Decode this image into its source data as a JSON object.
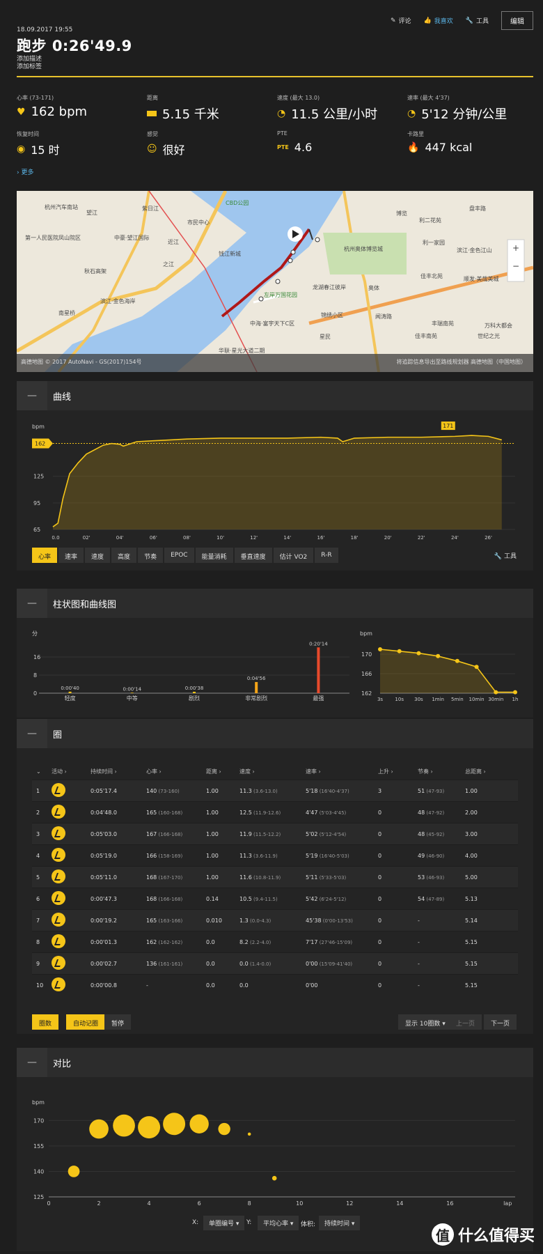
{
  "header": {
    "comment": "评论",
    "like": "我喜欢",
    "tools": "工具",
    "edit": "编辑",
    "date": "18.09.2017 19:55",
    "title": "跑步",
    "duration": "0:26'49.9",
    "add_desc": "添加描述",
    "add_tag": "添加标签"
  },
  "stats": {
    "hr_label": "心率 (73-171)",
    "hr_val": "162 bpm",
    "dist_label": "距离",
    "dist_val": "5.15 千米",
    "speed_label": "速度 (最大 13.0)",
    "speed_val": "11.5 公里/小时",
    "pace_label": "速率 (最大 4'37)",
    "pace_val": "5'12 分钟/公里",
    "recovery_label": "恢复时间",
    "recovery_val": "15 时",
    "feel_label": "感觉",
    "feel_val": "很好",
    "pte_label": "PTE",
    "pte_val": "4.6",
    "cal_label": "卡路里",
    "cal_val": "447 kcal",
    "more": "更多"
  },
  "map": {
    "labels": [
      "杭州汽车南站",
      "望江",
      "紫日江",
      "CBD公园",
      "博览",
      "利二花苑",
      "盘丰路",
      "第一人民医院凤山院区",
      "中豪·望江国际",
      "近江",
      "市民中心",
      "钱江新城",
      "杭州奥体博览城",
      "利一家园",
      "滨江·金色江山",
      "秋石高架",
      "之江",
      "龙湖春江彼岸",
      "佳丰北苑",
      "顺发·美哉美城",
      "左岸万国花园",
      "滨江·金色海岸",
      "南星桥",
      "中海·富宇天下C区",
      "锦绣小区",
      "奥体",
      "丰瑞南苑",
      "万科大都会",
      "星民",
      "华联·星光大道二期",
      "闻涛路",
      "世纪之光",
      "佳丰南苑"
    ],
    "footer_left": "高德地图 © 2017 AutoNavi - GS(2017)154号",
    "footer_right": "将追踪信息导出至路线规划器    高德地图（中国地图）"
  },
  "curve": {
    "title": "曲线",
    "unit": "bpm",
    "avg_label": "162",
    "max_label": "171",
    "yticks": [
      "125",
      "95",
      "65"
    ],
    "xticks": [
      "0.0",
      "02'",
      "04'",
      "06'",
      "08'",
      "10'",
      "12'",
      "14'",
      "16'",
      "18'",
      "20'",
      "22'",
      "24'",
      "26'"
    ],
    "tabs": [
      "心率",
      "速率",
      "速度",
      "高度",
      "节奏",
      "EPOC",
      "能量消耗",
      "垂直速度",
      "估计 VO2",
      "R-R"
    ],
    "tools": "工具"
  },
  "chart_data": [
    {
      "type": "line",
      "title": "",
      "ylabel": "bpm",
      "ylim": [
        65,
        175
      ],
      "x_unit": "minutes",
      "x": [
        0,
        0.3,
        0.6,
        1,
        1.5,
        2,
        3,
        3.5,
        4,
        4.2,
        5,
        6,
        8,
        10,
        12,
        14,
        16,
        17,
        17.3,
        18,
        20,
        22,
        24,
        25,
        26,
        26.8
      ],
      "series": [
        {
          "name": "",
          "values": [
            68,
            72,
            100,
            128,
            140,
            150,
            160,
            162,
            161,
            159,
            164,
            165,
            167,
            168,
            168,
            168,
            169,
            168,
            164,
            168,
            169,
            169,
            170,
            171,
            170,
            166
          ]
        }
      ],
      "average": 162,
      "max": 171
    },
    {
      "type": "bar",
      "title": "",
      "ylabel": "分",
      "categories": [
        "轻度",
        "中等",
        "剧烈",
        "非常剧烈",
        "最强"
      ],
      "values": [
        0.67,
        0.23,
        0.63,
        4.93,
        20.23
      ],
      "labels": [
        "0:00'40",
        "0:00'14",
        "0:00'38",
        "0:04'56",
        "0:20'14"
      ],
      "yticks": [
        "16",
        "8",
        "0"
      ],
      "ylim": [
        0,
        24
      ]
    },
    {
      "type": "area",
      "title": "",
      "ylabel": "bpm",
      "categories": [
        "3s",
        "10s",
        "30s",
        "1min",
        "5min",
        "10min",
        "30min",
        "1h"
      ],
      "values": [
        171,
        170.6,
        170.2,
        169.6,
        168.6,
        167.4,
        162.2,
        162.2
      ],
      "yticks": [
        "170",
        "166",
        "162"
      ],
      "ylim": [
        162,
        172
      ]
    },
    {
      "type": "scatter",
      "title": "",
      "ylabel": "bpm",
      "xlabel": "lap",
      "x": [
        1,
        2,
        3,
        4,
        5,
        6,
        7,
        8,
        9
      ],
      "y": [
        140,
        165,
        167,
        166,
        168,
        168,
        165,
        162,
        136
      ],
      "sizes": [
        17.4,
        48,
        63,
        79,
        71,
        47,
        19,
        1.3,
        2.7
      ],
      "xlim": [
        0,
        18
      ],
      "ylim": [
        125,
        180
      ]
    }
  ],
  "histogram": {
    "title": "柱状图和曲线图",
    "bars": {
      "unit": "分",
      "yticks": [
        "16",
        "8",
        "0"
      ],
      "categories": [
        "轻度",
        "中等",
        "剧烈",
        "非常剧烈",
        "最强"
      ],
      "labels": [
        "0:00'40",
        "0:00'14",
        "0:00'38",
        "0:04'56",
        "0:20'14"
      ],
      "colors": [
        "#f5c518",
        "#f5c518",
        "#f5c518",
        "#f5a518",
        "#e84a2c"
      ]
    },
    "curve": {
      "unit": "bpm",
      "yticks": [
        "170",
        "166",
        "162"
      ],
      "xticks": [
        "3s",
        "10s",
        "30s",
        "1min",
        "5min",
        "10min",
        "30min",
        "1h"
      ]
    }
  },
  "laps": {
    "title": "圈",
    "headers": [
      "活动",
      "持续时间",
      "心率",
      "距离",
      "速度",
      "速率",
      "上升",
      "节奏",
      "总距离"
    ],
    "rows": [
      {
        "n": "1",
        "dur": "0:05'17.4",
        "hr": "140",
        "hr_r": "(73-160)",
        "dist": "1.00",
        "spd": "11.3",
        "spd_r": "(3.6-13.0)",
        "pace": "5'18",
        "pace_r": "(16'40-4'37)",
        "asc": "3",
        "cad": "51",
        "cad_r": "(47-93)",
        "tot": "1.00"
      },
      {
        "n": "2",
        "dur": "0:04'48.0",
        "hr": "165",
        "hr_r": "(160-168)",
        "dist": "1.00",
        "spd": "12.5",
        "spd_r": "(11.9-12.6)",
        "pace": "4'47",
        "pace_r": "(5'03-4'45)",
        "asc": "0",
        "cad": "48",
        "cad_r": "(47-92)",
        "tot": "2.00"
      },
      {
        "n": "3",
        "dur": "0:05'03.0",
        "hr": "167",
        "hr_r": "(166-168)",
        "dist": "1.00",
        "spd": "11.9",
        "spd_r": "(11.5-12.2)",
        "pace": "5'02",
        "pace_r": "(5'12-4'54)",
        "asc": "0",
        "cad": "48",
        "cad_r": "(45-92)",
        "tot": "3.00"
      },
      {
        "n": "4",
        "dur": "0:05'19.0",
        "hr": "166",
        "hr_r": "(158-169)",
        "dist": "1.00",
        "spd": "11.3",
        "spd_r": "(3.6-11.9)",
        "pace": "5'19",
        "pace_r": "(16'40-5'03)",
        "asc": "0",
        "cad": "49",
        "cad_r": "(46-90)",
        "tot": "4.00"
      },
      {
        "n": "5",
        "dur": "0:05'11.0",
        "hr": "168",
        "hr_r": "(167-170)",
        "dist": "1.00",
        "spd": "11.6",
        "spd_r": "(10.8-11.9)",
        "pace": "5'11",
        "pace_r": "(5'33-5'03)",
        "asc": "0",
        "cad": "53",
        "cad_r": "(46-93)",
        "tot": "5.00"
      },
      {
        "n": "6",
        "dur": "0:00'47.3",
        "hr": "168",
        "hr_r": "(166-168)",
        "dist": "0.14",
        "spd": "10.5",
        "spd_r": "(9.4-11.5)",
        "pace": "5'42",
        "pace_r": "(6'24-5'12)",
        "asc": "0",
        "cad": "54",
        "cad_r": "(47-89)",
        "tot": "5.13"
      },
      {
        "n": "7",
        "dur": "0:00'19.2",
        "hr": "165",
        "hr_r": "(163-166)",
        "dist": "0.010",
        "spd": "1.3",
        "spd_r": "(0.0-4.3)",
        "pace": "45'38",
        "pace_r": "(0'00-13'53)",
        "asc": "0",
        "cad": "-",
        "cad_r": "",
        "tot": "5.14"
      },
      {
        "n": "8",
        "dur": "0:00'01.3",
        "hr": "162",
        "hr_r": "(162-162)",
        "dist": "0.0",
        "spd": "8.2",
        "spd_r": "(2.2-4.0)",
        "pace": "7'17",
        "pace_r": "(27'46-15'09)",
        "asc": "0",
        "cad": "-",
        "cad_r": "",
        "tot": "5.15"
      },
      {
        "n": "9",
        "dur": "0:00'02.7",
        "hr": "136",
        "hr_r": "(161-161)",
        "dist": "0.0",
        "spd": "0.0",
        "spd_r": "(1.4-0.0)",
        "pace": "0'00",
        "pace_r": "(15'09-41'40)",
        "asc": "0",
        "cad": "-",
        "cad_r": "",
        "tot": "5.15"
      },
      {
        "n": "10",
        "dur": "0:00'00.8",
        "hr": "-",
        "hr_r": "",
        "dist": "0.0",
        "spd": "0.0",
        "spd_r": "",
        "pace": "0'00",
        "pace_r": "",
        "asc": "0",
        "cad": "-",
        "cad_r": "",
        "tot": "5.15"
      }
    ],
    "btn_laps": "圈数",
    "btn_auto": "自动记圈",
    "btn_pause": "暂停",
    "show": "显示 10圈数",
    "prev": "上一页",
    "next": "下一页"
  },
  "compare": {
    "title": "对比",
    "unit": "bpm",
    "yticks": [
      "170",
      "155",
      "140",
      "125"
    ],
    "xticks": [
      "0",
      "2",
      "4",
      "6",
      "8",
      "10",
      "12",
      "14",
      "16",
      "lap"
    ],
    "x_label": "X:",
    "x_sel": "单圈编号",
    "y_label": "Y:",
    "y_sel": "平均心率",
    "v_label": "体积:",
    "v_sel": "持续时间"
  },
  "watermark": {
    "logo": "值",
    "text": "什么值得买"
  }
}
